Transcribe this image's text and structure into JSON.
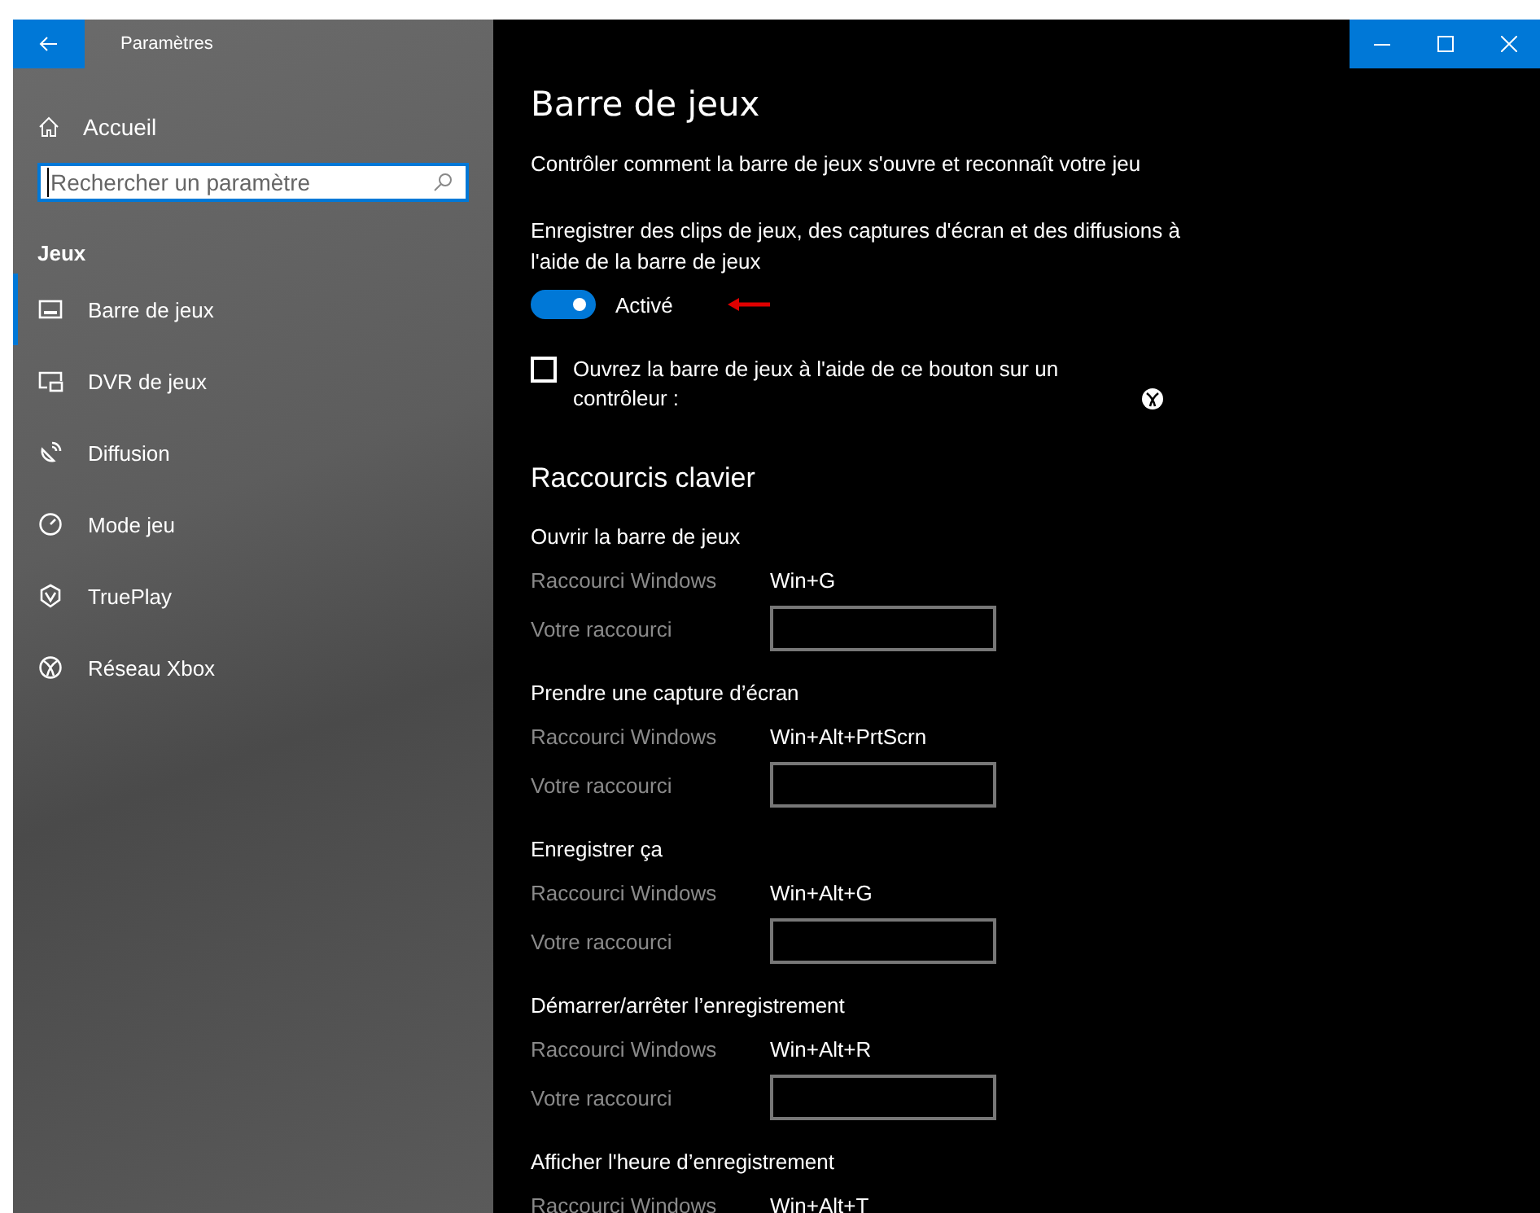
{
  "window": {
    "title": "Paramètres"
  },
  "sidebar": {
    "home": "Accueil",
    "search": {
      "placeholder": "Rechercher un paramètre"
    },
    "section": "Jeux",
    "items": [
      {
        "label": "Barre de jeux",
        "selected": true
      },
      {
        "label": "DVR de jeux",
        "selected": false
      },
      {
        "label": "Diffusion",
        "selected": false
      },
      {
        "label": "Mode jeu",
        "selected": false
      },
      {
        "label": "TruePlay",
        "selected": false
      },
      {
        "label": "Réseau Xbox",
        "selected": false
      }
    ]
  },
  "page": {
    "title": "Barre de jeux",
    "description": "Contrôler comment la barre de jeux s'ouvre et reconnaît votre jeu",
    "record": {
      "label": "Enregistrer des clips de jeux, des captures d'écran et des diffusions à l'aide de la barre de jeux",
      "on": true,
      "state": "Activé"
    },
    "controller": {
      "label": "Ouvrez la barre de jeux à l'aide de ce bouton sur un contrôleur :",
      "checked": false
    },
    "shortcuts_title": "Raccourcis clavier",
    "shortcuts": [
      {
        "name": "Ouvrir la barre de jeux",
        "windows_label": "Raccourci Windows",
        "windows": "Win+G",
        "yours_label": "Votre raccourci"
      },
      {
        "name": "Prendre une capture d’écran",
        "windows_label": "Raccourci Windows",
        "windows": "Win+Alt+PrtScrn",
        "yours_label": "Votre raccourci"
      },
      {
        "name": "Enregistrer ça",
        "windows_label": "Raccourci Windows",
        "windows": "Win+Alt+G",
        "yours_label": "Votre raccourci"
      },
      {
        "name": "Démarrer/arrêter l’enregistrement",
        "windows_label": "Raccourci Windows",
        "windows": "Win+Alt+R",
        "yours_label": "Votre raccourci"
      },
      {
        "name": "Afficher l'heure d’enregistrement",
        "windows_label": "Raccourci Windows",
        "windows": "Win+Alt+T"
      }
    ]
  }
}
